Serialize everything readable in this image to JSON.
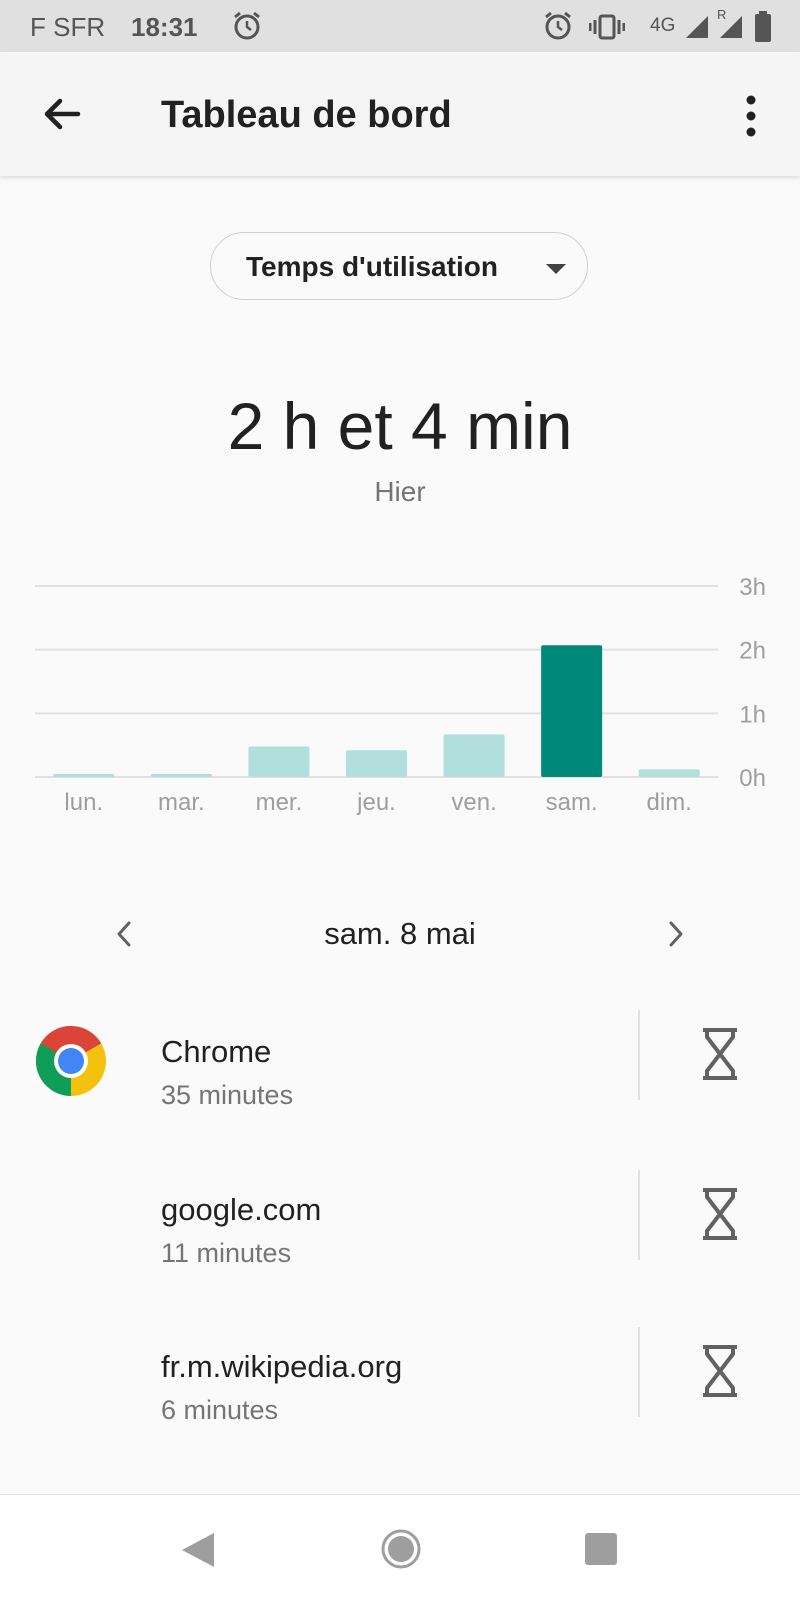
{
  "status_bar": {
    "carrier": "F SFR",
    "time": "18:31",
    "network": "4G",
    "roaming_mark": "R",
    "icons": [
      "alarm-icon",
      "alarm-icon",
      "vibrate-icon",
      "signal-icon",
      "signal-roaming-icon",
      "battery-icon"
    ]
  },
  "app_bar": {
    "title": "Tableau de bord",
    "back_icon": "arrow-back-icon",
    "menu_icon": "more-vert-icon"
  },
  "metric_selector": {
    "selected": "Temps d'utilisation",
    "icon": "caret-down-icon"
  },
  "summary": {
    "total": "2 h et 4 min",
    "period": "Hier"
  },
  "chart_data": {
    "type": "bar",
    "categories": [
      "lun.",
      "mar.",
      "mer.",
      "jeu.",
      "ven.",
      "sam.",
      "dim."
    ],
    "values": [
      0.05,
      0.05,
      0.48,
      0.42,
      0.67,
      2.07,
      0.12
    ],
    "unit": "h",
    "ylim": [
      0,
      3
    ],
    "y_ticks": [
      "0h",
      "1h",
      "2h",
      "3h"
    ],
    "highlighted_index": 5,
    "colors": {
      "highlight": "#00897b",
      "normal": "#b2dfdb",
      "grid": "#e0e0e0",
      "label": "#9e9e9e"
    },
    "grid": true
  },
  "day_nav": {
    "label": "sam. 8 mai",
    "prev_icon": "chevron-left-icon",
    "next_icon": "chevron-right-icon"
  },
  "apps": [
    {
      "name": "Chrome",
      "usage": "35 minutes",
      "icon": "chrome-icon"
    },
    {
      "name": "google.com",
      "usage": "11 minutes"
    },
    {
      "name": "fr.m.wikipedia.org",
      "usage": "6 minutes"
    }
  ],
  "nav_bar": {
    "icons": [
      "nav-back-icon",
      "nav-home-icon",
      "nav-recents-icon"
    ]
  }
}
